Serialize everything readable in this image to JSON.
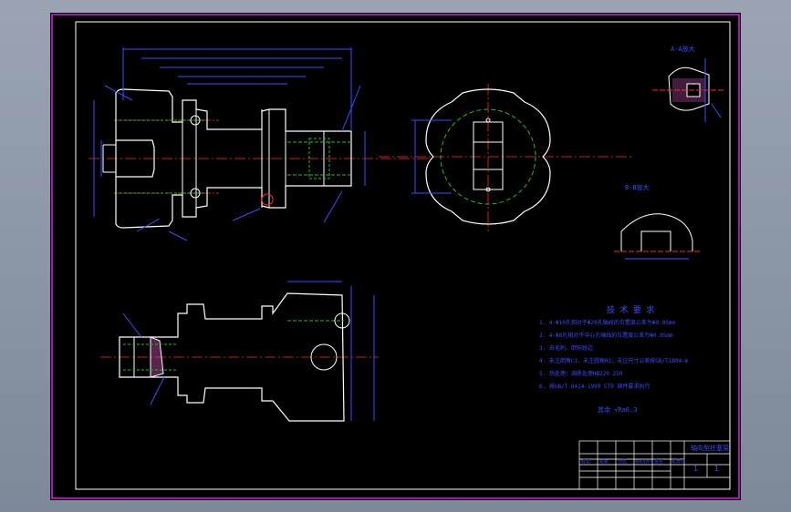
{
  "drawing": {
    "title_block": {
      "title": "轴向型柱塞泵",
      "cells": [
        "1",
        "1"
      ],
      "row_labels": [
        "标记",
        "处数",
        "分区",
        "更改文件号",
        "签名",
        "年月日"
      ]
    },
    "technical_requirements": {
      "heading": "技 术 要 求",
      "lines": [
        "1. 4-Φ10孔相对于Φ20孔轴线的位置度公差为Φ0.05mm",
        "2. 4-Φ8孔相对于中心孔轴线的位置度公差为Φ0.05mm",
        "3. 去毛刺、倒钝锐边",
        "4. 未注倒角C1，未注圆角R1，未注尺寸公差按GB/T1804-m",
        "5. 热处理：调质处理HB220-250",
        "6. 按GB/T 6414-1999 CT9 铸件要求执行"
      ]
    },
    "roughness_note": "其余 √Ra6.3",
    "view_labels": {
      "section_a": "A-A放大",
      "section_b": "B-B放大"
    },
    "colors": {
      "frame": "#e020e0",
      "outline": "#ffffff",
      "dimension": "#3a4cff",
      "centerline": "#ff2a2a",
      "hidden": "#20c020",
      "hatch": "#e080e0"
    }
  }
}
